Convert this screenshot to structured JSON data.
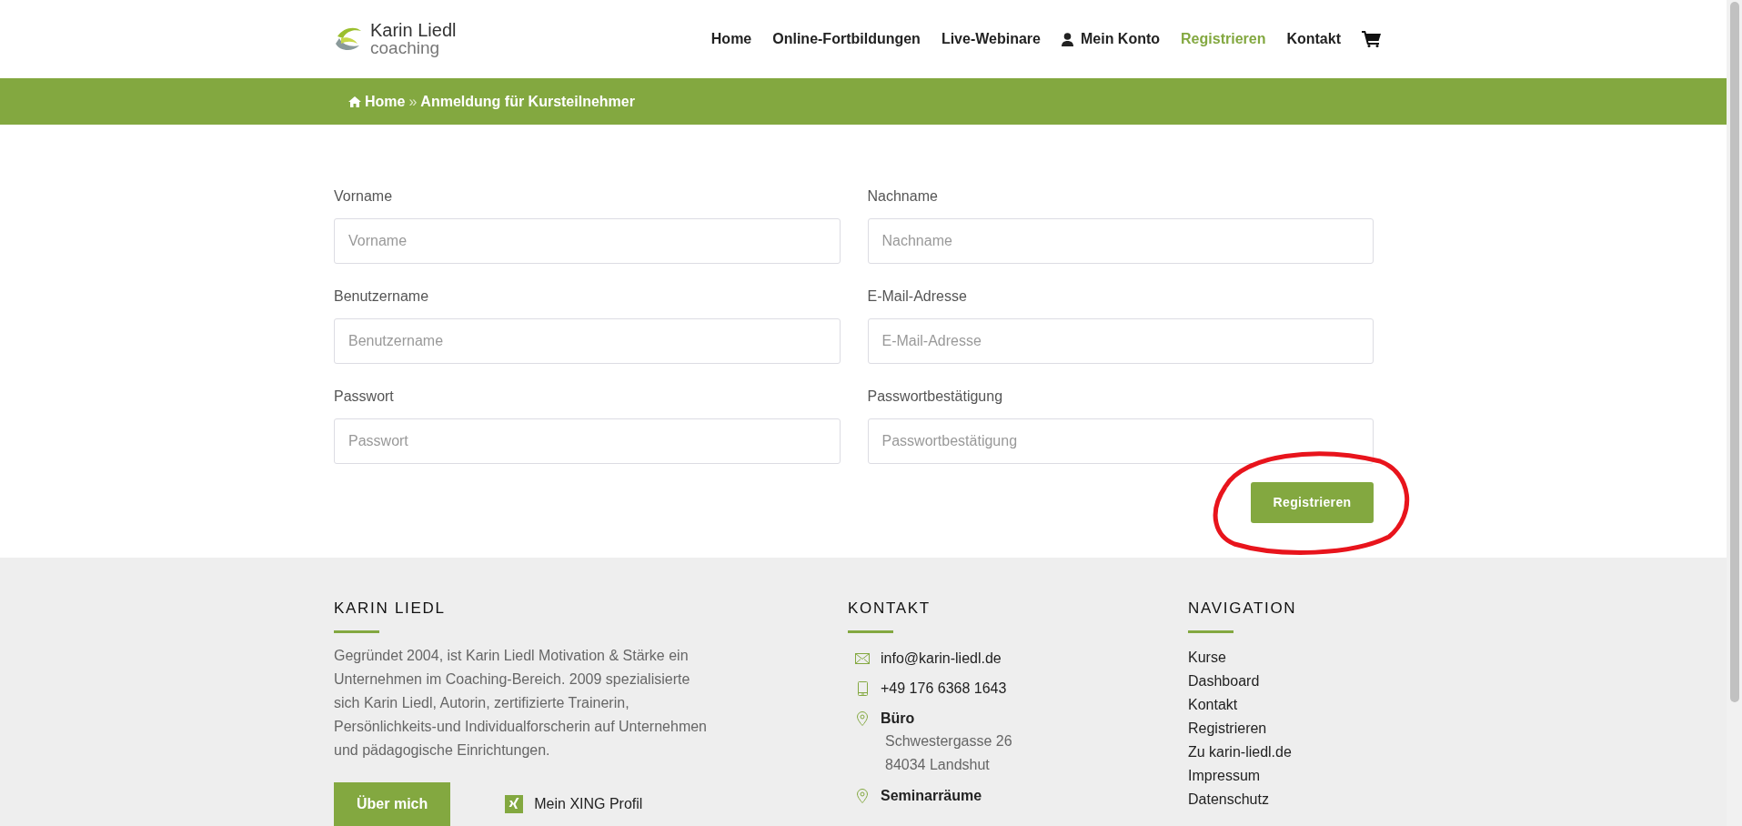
{
  "header": {
    "logo": {
      "name": "Karin Liedl",
      "tagline": "coaching"
    },
    "nav": [
      {
        "label": "Home",
        "selected": false,
        "kind": "text"
      },
      {
        "label": "Online-Fortbildungen",
        "selected": false,
        "kind": "text"
      },
      {
        "label": "Live-Webinare",
        "selected": false,
        "kind": "text"
      },
      {
        "label": "Mein Konto",
        "selected": false,
        "kind": "account"
      },
      {
        "label": "Registrieren",
        "selected": true,
        "kind": "text"
      },
      {
        "label": "Kontakt",
        "selected": false,
        "kind": "text"
      },
      {
        "selected": false,
        "kind": "cart"
      }
    ]
  },
  "breadcrumb": {
    "home": "Home",
    "separator": "»",
    "current": "Anmeldung für Kursteilnehmer"
  },
  "form": {
    "fields": [
      {
        "label": "Vorname",
        "placeholder": "Vorname"
      },
      {
        "label": "Nachname",
        "placeholder": "Nachname"
      },
      {
        "label": "Benutzername",
        "placeholder": "Benutzername"
      },
      {
        "label": "E-Mail-Adresse",
        "placeholder": "E-Mail-Adresse"
      },
      {
        "label": "Passwort",
        "placeholder": "Passwort"
      },
      {
        "label": "Passwortbestätigung",
        "placeholder": "Passwortbestätigung"
      }
    ],
    "submit": "Registrieren",
    "submit_circled": true
  },
  "footer": {
    "about": {
      "title": "KARIN LIEDL",
      "text": "Gegründet 2004, ist Karin Liedl Motivation & Stärke ein Unternehmen im Coaching-Bereich. 2009 spezialisierte sich Karin Liedl, Autorin, zertifizierte Trainerin, Persönlichkeits-und Individualforscherin auf Unternehmen und pädagogische Einrichtungen.",
      "button": "Über mich",
      "xing": "Mein XING Profil"
    },
    "contact": {
      "title": "KONTAKT",
      "items": [
        {
          "kind": "mail",
          "text": "info@karin-liedl.de"
        },
        {
          "kind": "phone",
          "text": "+49 176 6368 1643"
        },
        {
          "kind": "place",
          "text": "Büro",
          "lines": [
            "Schwestergasse 26",
            "84034 Landshut"
          ]
        },
        {
          "kind": "place",
          "text": "Seminarräume"
        }
      ]
    },
    "navigation": {
      "title": "NAVIGATION",
      "links": [
        "Kurse",
        "Dashboard",
        "Kontakt",
        "Registrieren",
        "Zu karin-liedl.de",
        "Impressum",
        "Datenschutz"
      ]
    }
  }
}
